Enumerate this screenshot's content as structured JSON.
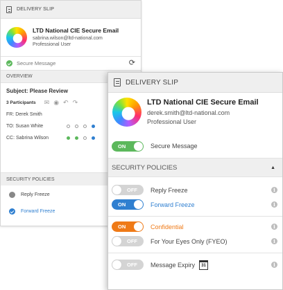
{
  "back": {
    "header_title": "DELIVERY SLIP",
    "sender": {
      "org": "LTD National CIE Secure Email",
      "email": "sabrina.wilson@ltd-national.com",
      "role": "Professional User"
    },
    "secure_message_label": "Secure Message",
    "overview_label": "OVERVIEW",
    "subject": "Subject: Please Review",
    "participants_label": "3 Participants",
    "from_line": "FR:  Derek Smith",
    "to_line": "TO:  Susan White",
    "cc_line": "CC:  Sabrina Wilson",
    "security_policies_label": "SECURITY POLICIES",
    "policies": [
      "Reply Freeze",
      "Forward Freeze"
    ]
  },
  "front": {
    "header_title": "DELIVERY SLIP",
    "sender": {
      "org": "LTD National CIE Secure Email",
      "email": "derek.smith@ltd-national.com",
      "role": "Professional User"
    },
    "secure_message": {
      "state": "ON",
      "label": "Secure Message"
    },
    "security_policies_label": "SECURITY POLICIES",
    "policies": [
      {
        "state": "OFF",
        "label": "Reply Freeze"
      },
      {
        "state": "ON",
        "label": "Forward Freeze"
      },
      {
        "state": "ON",
        "label": "Confidential"
      },
      {
        "state": "OFF",
        "label": "For Your Eyes Only (FYEO)"
      },
      {
        "state": "OFF",
        "label": "Message Expiry"
      }
    ],
    "calendar_day": "31",
    "info_glyph": "i"
  },
  "colors": {
    "green": "#5cb85c",
    "blue": "#2f7fd0",
    "orange": "#ef7a17",
    "gray": "#d4d4d4"
  }
}
